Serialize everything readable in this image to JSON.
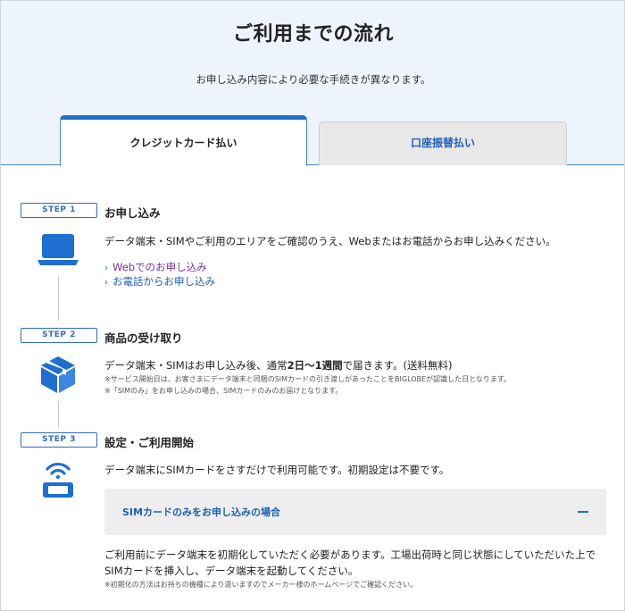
{
  "header": {
    "title": "ご利用までの流れ",
    "subtitle": "お申し込み内容により必要な手続きが異なります。"
  },
  "tabs": [
    {
      "label": "クレジットカード払い",
      "active": true
    },
    {
      "label": "口座振替払い",
      "active": false
    }
  ],
  "steps": [
    {
      "badge": "STEP 1",
      "title": "お申し込み",
      "icon": "laptop-icon",
      "text": "データ端末・SIMやご利用のエリアをご確認のうえ、Webまたはお電話からお申し込みください。",
      "links": [
        {
          "label": "Webでのお申し込み",
          "visited": true
        },
        {
          "label": "お電話からお申し込み",
          "visited": false
        }
      ]
    },
    {
      "badge": "STEP 2",
      "title": "商品の受け取り",
      "icon": "package-box-icon",
      "text_pre": "データ端末・SIMはお申し込み後、通常",
      "text_bold": "2日〜1週間",
      "text_post": "で届きます。(送料無料)",
      "notes": [
        "※サービス開始日は、お客さまにデータ端末と同梱のSIMカードの引き渡しがあったことをBIGLOBEが認識した日となります。",
        "※「SIMのみ」をお申し込みの場合、SIMカードのみのお届けとなります。"
      ]
    },
    {
      "badge": "STEP 3",
      "title": "設定・ご利用開始",
      "icon": "wifi-router-icon",
      "text": "データ端末にSIMカードをさすだけで利用可能です。初期設定は不要です。",
      "accordion": {
        "label": "SIMカードのみをお申し込みの場合",
        "expanded": true
      },
      "detail_text": "ご利用前にデータ端末を初期化していただく必要があります。工場出荷時と同じ状態にしていただいた上でSIMカードを挿入し、データ端末を起動してください。",
      "detail_note": "※初期化の方法はお持ちの機種により違いますのでメーカー様のホームページでご確認ください。"
    }
  ],
  "colors": {
    "accent": "#1e6fd0",
    "hero_bg": "#eef4fd",
    "link": "#1e5fb8",
    "visited_link": "#7b2ea8"
  }
}
